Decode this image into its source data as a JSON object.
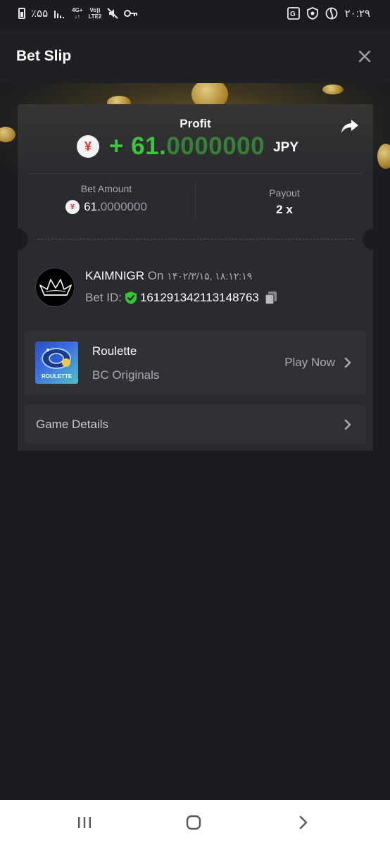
{
  "status_bar": {
    "battery": "٪۵۵",
    "network_top": "4G+",
    "network_bottom": "↓↑",
    "volte_top": "Vo))",
    "volte_bottom": "LTE2",
    "time": "۲۰:۲۹",
    "icons": [
      "battery-icon",
      "signal-icon",
      "mute-icon",
      "key-icon",
      "translate-icon",
      "shield-status-icon",
      "app-status-icon"
    ]
  },
  "header": {
    "title": "Bet Slip",
    "close_icon": "close-icon"
  },
  "profit": {
    "label": "Profit",
    "currency_symbol": "¥",
    "sign": "+",
    "value_main": "61.",
    "value_decimals": "0000000",
    "currency": "JPY",
    "color": "#3fc23f"
  },
  "bet_amount": {
    "label": "Bet Amount",
    "currency_symbol": "¥",
    "value_main": "61.",
    "value_decimals": "0000000"
  },
  "payout": {
    "label": "Payout",
    "value": "2 x"
  },
  "user": {
    "name": "KAIMNIGR",
    "on": "On",
    "date": "۱۴۰۲/۳/۱۵, ۱۸:۱۲:۱۹",
    "bet_id_label": "Bet ID:",
    "bet_id": "161291342113148763"
  },
  "game": {
    "title": "Roulette",
    "subtitle": "BC Originals",
    "thumb_label": "ROULETTE",
    "play_label": "Play Now"
  },
  "details": {
    "label": "Game Details"
  },
  "nav": {
    "icons": [
      "recents-icon",
      "home-icon",
      "back-icon"
    ]
  }
}
